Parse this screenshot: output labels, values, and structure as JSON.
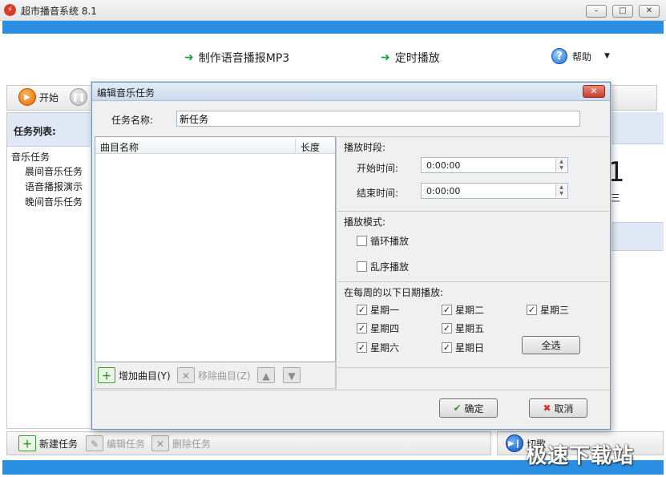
{
  "app": {
    "title": "超市播音系统 8.1",
    "icon": "app-logo-icon"
  },
  "window_buttons": {
    "minimize": "–",
    "maximize": "□",
    "close": "✕"
  },
  "nav": {
    "make_mp3": "制作语音播报MP3",
    "schedule": "定时播放",
    "help": "帮助",
    "help_caret": "▼",
    "arrow": "➜",
    "help_glyph": "?"
  },
  "toolbar": {
    "start_label": "开始"
  },
  "left_panel": {
    "header": "任务列表:",
    "root": "音乐任务",
    "items": [
      "晨间音乐任务",
      "语音播报演示",
      "晚间音乐任务"
    ]
  },
  "bg_right": {
    "big_char": "1",
    "weekday": "三"
  },
  "bottom_toolbar": {
    "new_task": "新建任务",
    "edit_task": "编辑任务",
    "delete_task": "删除任务",
    "right_label": "切歌"
  },
  "dialog": {
    "title": "编辑音乐任务",
    "close": "✕",
    "task_name_label": "任务名称:",
    "task_name_value": "新任务",
    "list": {
      "col_name": "曲目名称",
      "col_length": "长度",
      "rows": []
    },
    "list_toolbar": {
      "add": "增加曲目(Y)",
      "remove": "移除曲目(Z)"
    },
    "play_period": {
      "label": "播放时段:",
      "start_label": "开始时间:",
      "start_value": "0:00:00",
      "end_label": "结束时间:",
      "end_value": "0:00:00"
    },
    "play_mode": {
      "label": "播放模式:",
      "loop": {
        "label": "循环播放",
        "checked": false
      },
      "shuffle": {
        "label": "乱序播放",
        "checked": false
      }
    },
    "weekdays": {
      "label": "在每周的以下日期播放:",
      "days": [
        {
          "label": "星期一",
          "checked": true
        },
        {
          "label": "星期二",
          "checked": true
        },
        {
          "label": "星期三",
          "checked": true
        },
        {
          "label": "星期四",
          "checked": true
        },
        {
          "label": "星期五",
          "checked": true
        },
        {
          "label": "星期六",
          "checked": true
        },
        {
          "label": "星期日",
          "checked": true
        }
      ],
      "select_all": "全选"
    },
    "ok": "确定",
    "cancel": "取消"
  },
  "watermark": "极速下载站",
  "colors": {
    "accent_blue": "#2a8fe2",
    "green_arrow": "#1ea13a"
  }
}
